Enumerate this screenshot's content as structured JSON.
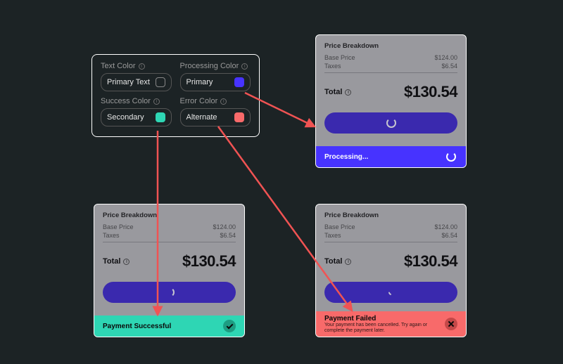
{
  "colors": {
    "processing": "#4733ff",
    "success": "#2ed6b4",
    "error": "#f86a6a",
    "button": "#3a23d1",
    "arrow": "#f05353"
  },
  "panel": {
    "text_color": {
      "label": "Text Color",
      "value": "Primary Text"
    },
    "processing": {
      "label": "Processing Color",
      "value": "Primary"
    },
    "success": {
      "label": "Success Color",
      "value": "Secondary"
    },
    "error": {
      "label": "Error Color",
      "value": "Alternate"
    }
  },
  "breakdown": {
    "title": "Price Breakdown",
    "base_label": "Base Price",
    "base_value": "$124.00",
    "tax_label": "Taxes",
    "tax_value": "$6.54",
    "total_label": "Total",
    "total_value": "$130.54"
  },
  "status": {
    "processing": "Processing...",
    "success": "Payment Successful",
    "failed_title": "Payment Failed",
    "failed_msg": "Your payment has been cancelled. Try again or complete the payment later."
  }
}
